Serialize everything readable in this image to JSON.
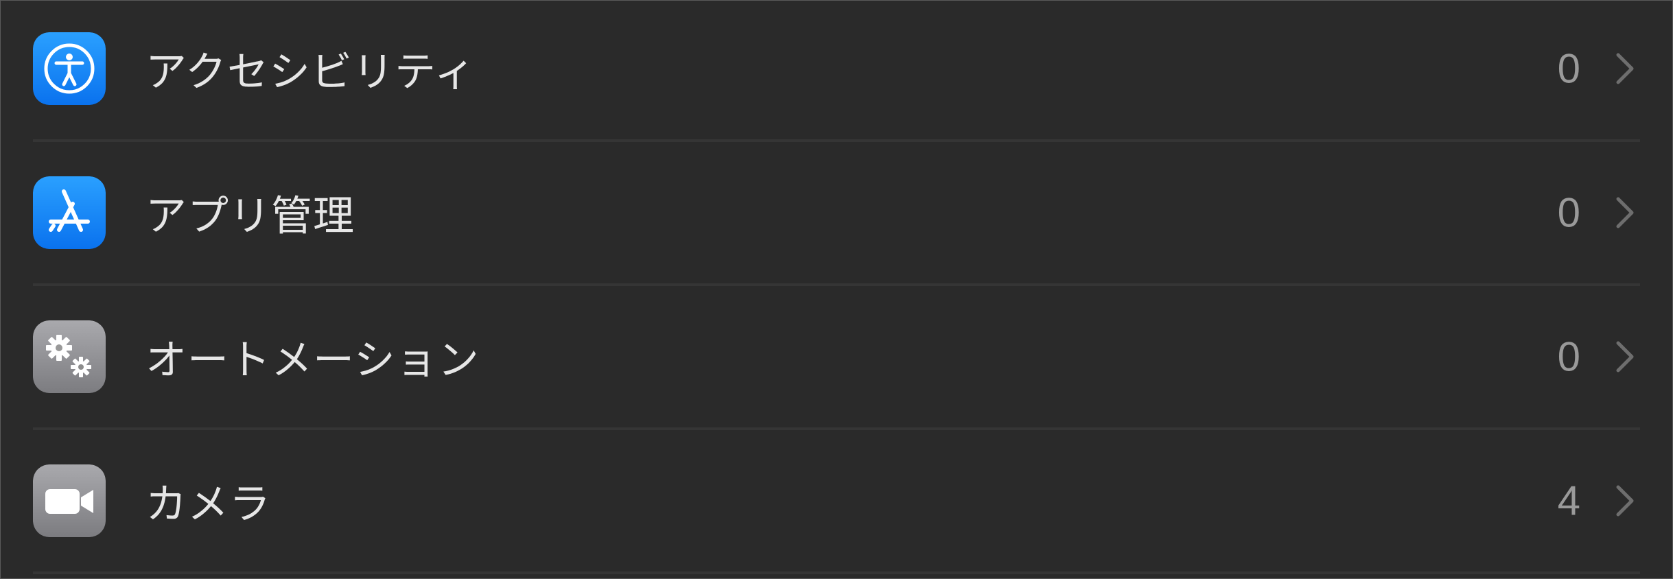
{
  "privacy_list": {
    "items": [
      {
        "label": "アクセシビリティ",
        "count": "0",
        "icon": "accessibility-icon",
        "icon_color": "#1a8cff"
      },
      {
        "label": "アプリ管理",
        "count": "0",
        "icon": "app-store-icon",
        "icon_color": "#1a8cff"
      },
      {
        "label": "オートメーション",
        "count": "0",
        "icon": "gears-icon",
        "icon_color": "#8e8e93"
      },
      {
        "label": "カメラ",
        "count": "4",
        "icon": "video-camera-icon",
        "icon_color": "#8e8e93"
      }
    ]
  },
  "colors": {
    "background": "#2a2a2a",
    "label_text": "#e6e6e6",
    "count_text": "#9a9a9a",
    "chevron": "#6e6e6e",
    "divider": "#353535"
  }
}
